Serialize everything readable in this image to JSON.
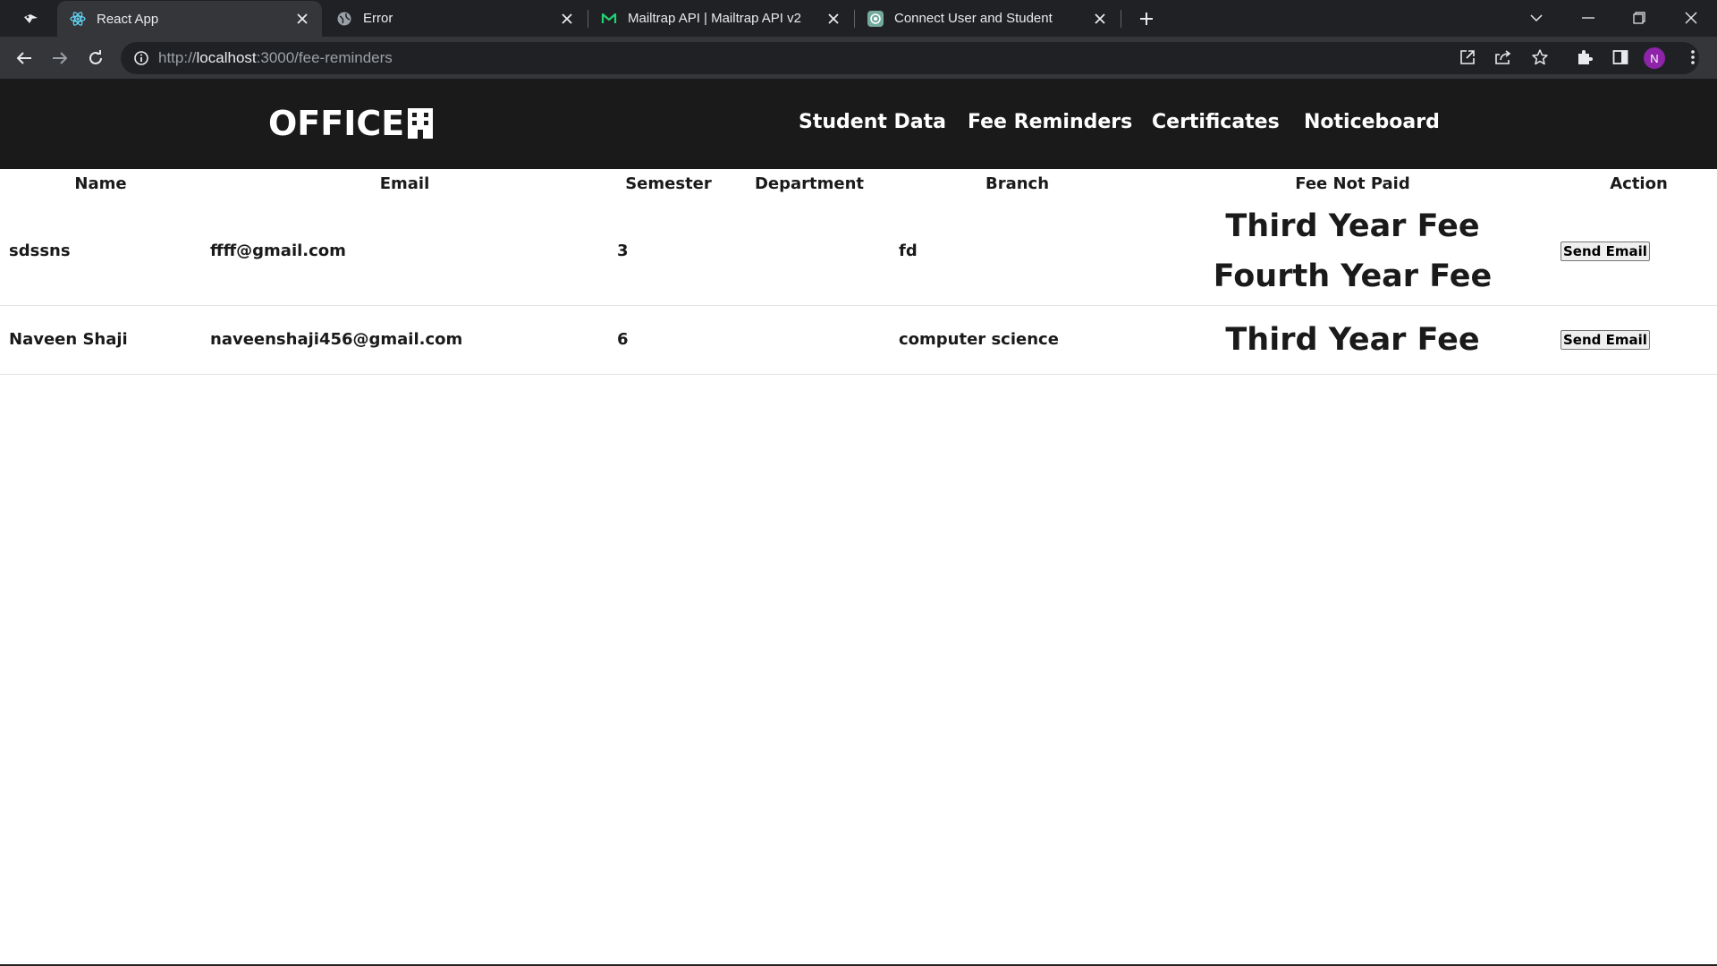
{
  "browser": {
    "tabs": [
      {
        "title": "React App",
        "favicon": "react-icon",
        "active": true
      },
      {
        "title": "Error",
        "favicon": "globe-icon",
        "active": false
      },
      {
        "title": "Mailtrap API | Mailtrap API v2",
        "favicon": "mailtrap-icon",
        "active": false
      },
      {
        "title": "Connect User and Student",
        "favicon": "chatgpt-icon",
        "active": false
      }
    ],
    "url_scheme": "http://",
    "url_host": "localhost",
    "url_path": ":3000/fee-reminders",
    "profile_initial": "N",
    "colors": {
      "tabstrip": "#202124",
      "toolbar": "#35363a",
      "avatar": "#8e24aa"
    }
  },
  "app": {
    "brand": "OFFICE",
    "brand_icon": "office-building-icon",
    "nav": {
      "student_data": "Student Data",
      "fee_reminders": "Fee Reminders",
      "certificates": "Certificates",
      "noticeboard": "Noticeboard"
    }
  },
  "table": {
    "headers": {
      "name": "Name",
      "email": "Email",
      "semester": "Semester",
      "department": "Department",
      "branch": "Branch",
      "fee_not_paid": "Fee Not Paid",
      "action": "Action"
    },
    "rows": [
      {
        "name": "sdssns",
        "email": "ffff@gmail.com",
        "semester": "3",
        "department": "",
        "branch": "fd",
        "fees": [
          "Third Year Fee",
          "Fourth Year Fee"
        ],
        "action": "Send Email"
      },
      {
        "name": "Naveen Shaji",
        "email": "naveenshaji456@gmail.com",
        "semester": "6",
        "department": "",
        "branch": "computer science",
        "fees": [
          "Third Year Fee"
        ],
        "action": "Send Email"
      }
    ]
  }
}
